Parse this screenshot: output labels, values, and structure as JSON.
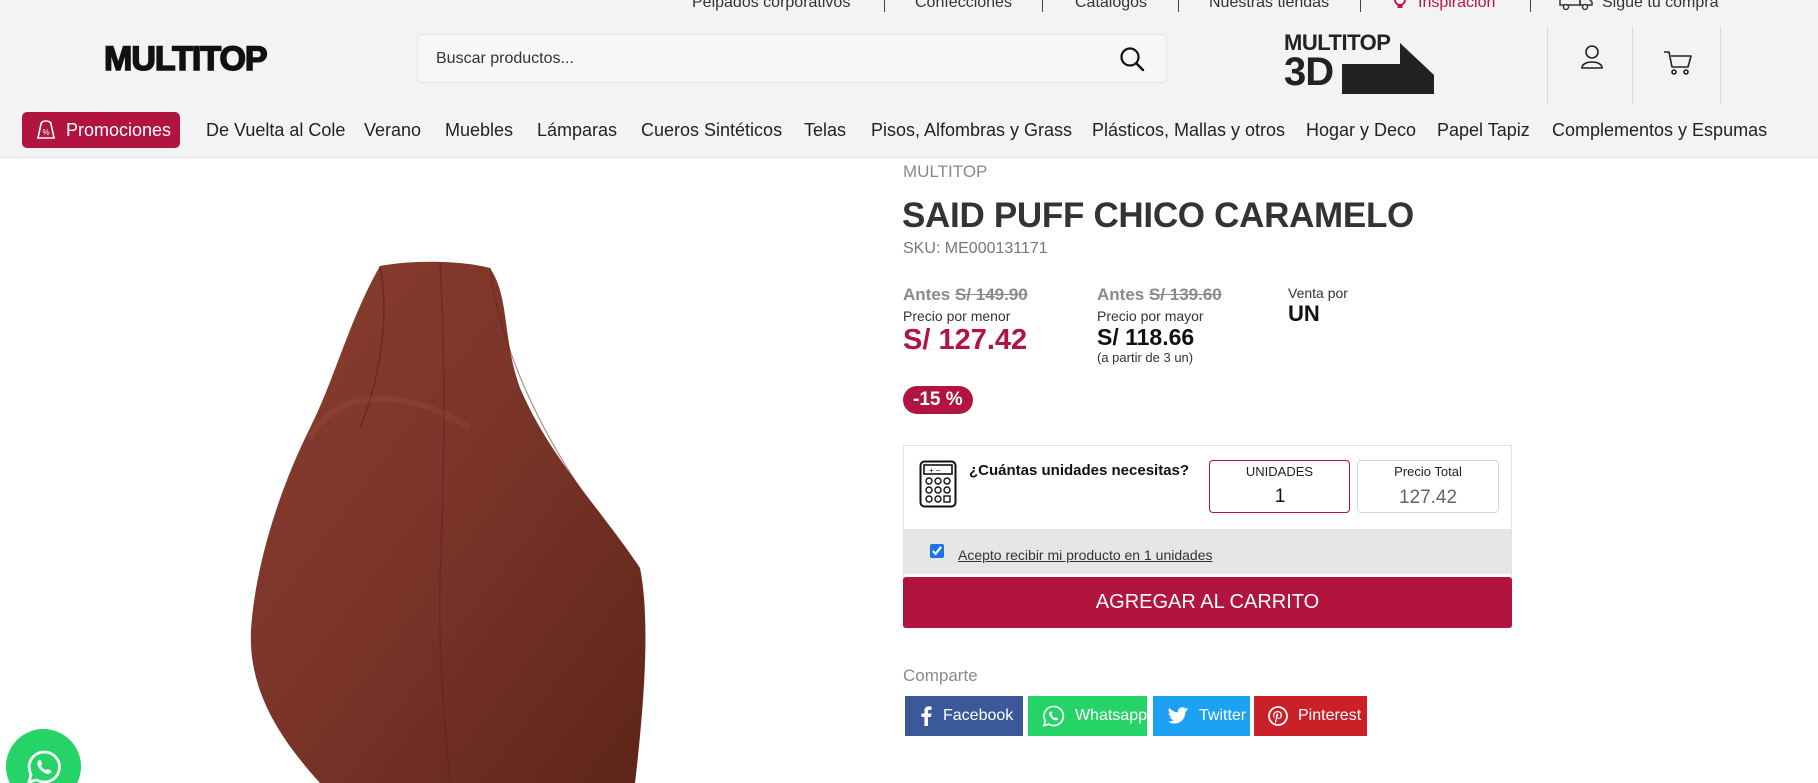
{
  "top_links": [
    "Pelpados corporativos",
    "Confecciones",
    "Catálogos",
    "Nuestras tiendas",
    "Inspiración",
    "Sigue tu compra"
  ],
  "brand_logo": "MULTITOP",
  "search": {
    "placeholder": "Buscar productos..."
  },
  "logo3d": {
    "top": "MULTITOP",
    "bottom": "3D"
  },
  "nav": {
    "promo_label": "Promociones",
    "items": [
      "De Vuelta al Cole",
      "Verano",
      "Muebles",
      "Lámparas",
      "Cueros Sintéticos",
      "Telas",
      "Pisos, Alfombras y Grass",
      "Plásticos, Mallas y otros",
      "Hogar y Deco",
      "Papel Tapiz",
      "Complementos y Espumas"
    ]
  },
  "product": {
    "brand": "MULTITOP",
    "title": "SAID PUFF CHICO CARAMELO",
    "sku": "SKU: ME000131171",
    "retail": {
      "antes_label": "Antes",
      "antes_price": "S/ 149.90",
      "label": "Precio por menor",
      "price": "S/ 127.42"
    },
    "wholesale": {
      "antes_label": "Antes",
      "antes_price": "S/ 139.60",
      "label": "Precio por mayor",
      "price": "S/ 118.66",
      "note": "(a partir de 3 un)"
    },
    "venta_label": "Venta por",
    "venta_value": "UN",
    "discount": "-15 %",
    "image_color": "#7a3428"
  },
  "quantity": {
    "question": "¿Cuántas unidades necesitas?",
    "units_label": "UNIDADES",
    "units_value": "1",
    "total_label": "Precio Total",
    "total_value": "127.42",
    "accept_text": "Acepto recibir mi producto en 1 unidades",
    "accept_checked": true,
    "add_to_cart": "AGREGAR AL CARRITO"
  },
  "share": {
    "label": "Comparte",
    "buttons": [
      {
        "label": "Facebook",
        "color": "#3b5998"
      },
      {
        "label": "Whatsapp",
        "color": "#25d366"
      },
      {
        "label": "Twitter",
        "color": "#1da1f2"
      },
      {
        "label": "Pinterest",
        "color": "#cb2027"
      }
    ]
  },
  "colors": {
    "accent": "#b0143f",
    "header_bg": "#f3f3f3"
  }
}
